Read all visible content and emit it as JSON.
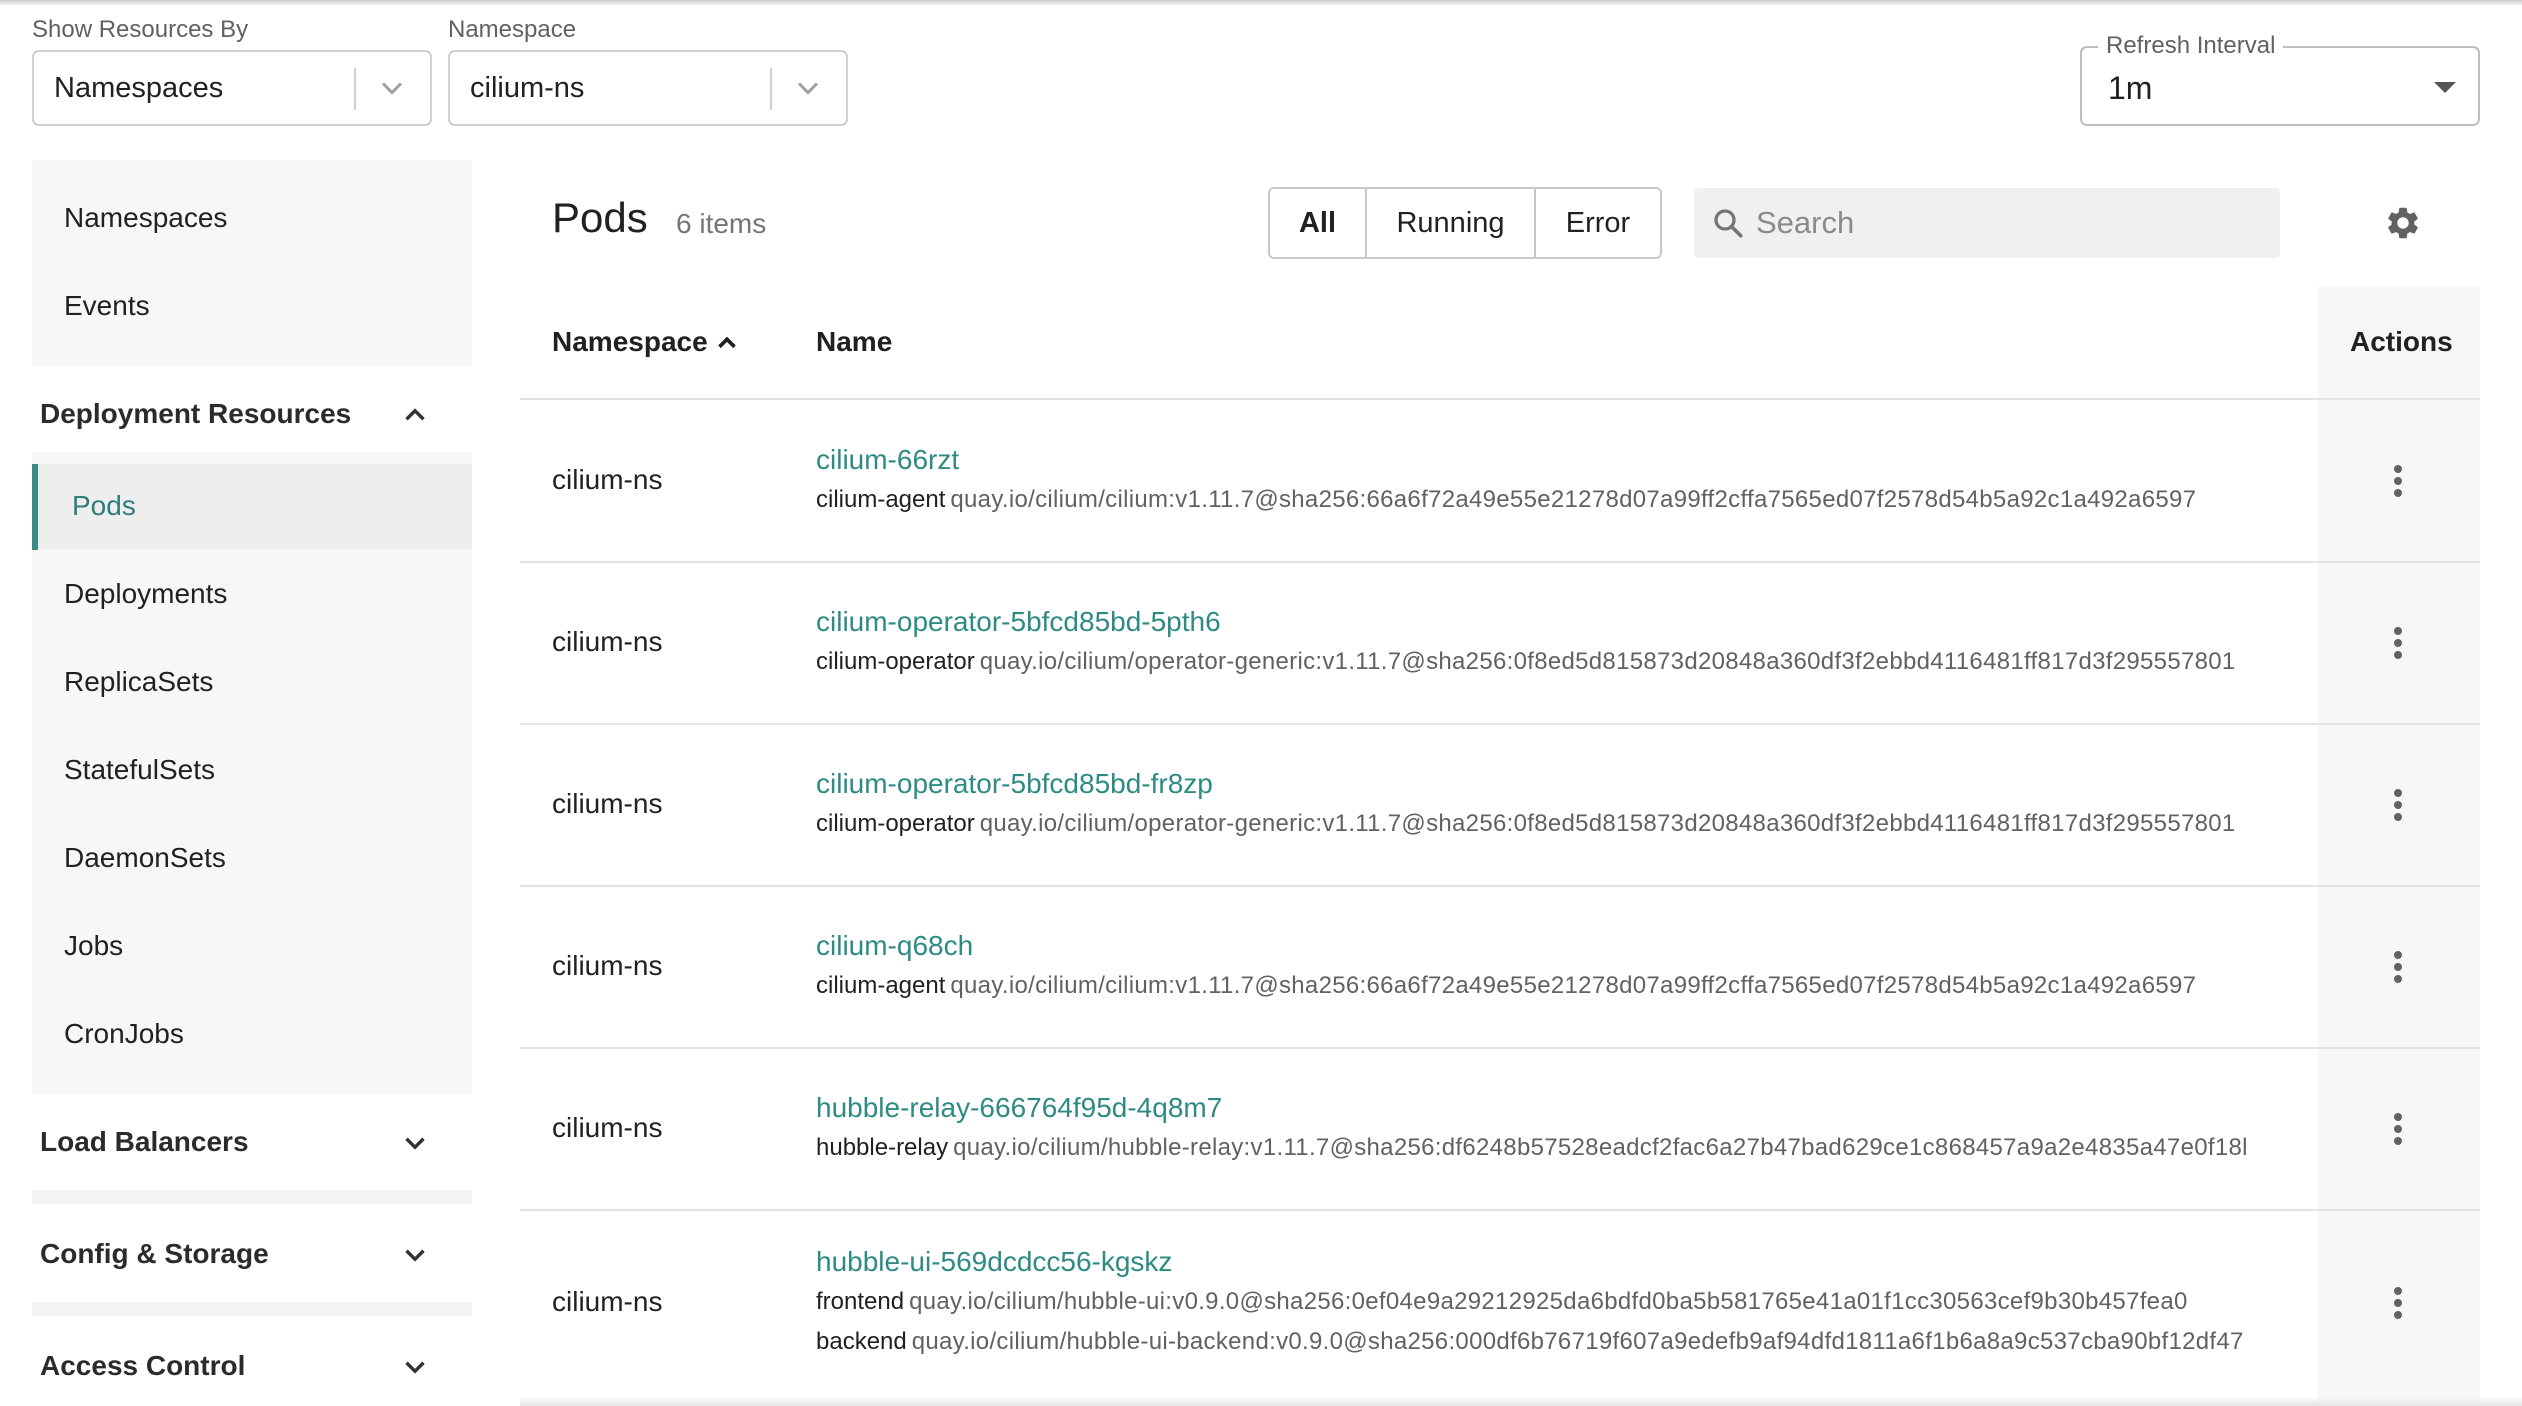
{
  "filters": {
    "show_resources_by": {
      "label": "Show Resources By",
      "value": "Namespaces"
    },
    "namespace": {
      "label": "Namespace",
      "value": "cilium-ns"
    },
    "refresh_interval": {
      "label": "Refresh Interval",
      "value": "1m"
    }
  },
  "sidebar": {
    "top_items": [
      "Namespaces",
      "Events"
    ],
    "deployment_resources": {
      "title": "Deployment Resources",
      "expanded": true,
      "items": [
        "Pods",
        "Deployments",
        "ReplicaSets",
        "StatefulSets",
        "DaemonSets",
        "Jobs",
        "CronJobs"
      ],
      "active": "Pods"
    },
    "sections": [
      "Load Balancers",
      "Config & Storage",
      "Access Control"
    ]
  },
  "main": {
    "title": "Pods",
    "count": "6 items",
    "status_filters": [
      "All",
      "Running",
      "Error"
    ],
    "active_filter": "All",
    "search_placeholder": "Search",
    "columns": {
      "namespace": "Namespace",
      "name": "Name",
      "actions": "Actions"
    },
    "rows": [
      {
        "namespace": "cilium-ns",
        "name": "cilium-66rzt",
        "containers": [
          {
            "name": "cilium-agent",
            "image": "quay.io/cilium/cilium:v1.11.7@sha256:66a6f72a49e55e21278d07a99ff2cffa7565ed07f2578d54b5a92c1a492a6597"
          }
        ]
      },
      {
        "namespace": "cilium-ns",
        "name": "cilium-operator-5bfcd85bd-5pth6",
        "containers": [
          {
            "name": "cilium-operator",
            "image": "quay.io/cilium/operator-generic:v1.11.7@sha256:0f8ed5d815873d20848a360df3f2ebbd4116481ff817d3f295557801"
          }
        ]
      },
      {
        "namespace": "cilium-ns",
        "name": "cilium-operator-5bfcd85bd-fr8zp",
        "containers": [
          {
            "name": "cilium-operator",
            "image": "quay.io/cilium/operator-generic:v1.11.7@sha256:0f8ed5d815873d20848a360df3f2ebbd4116481ff817d3f295557801"
          }
        ]
      },
      {
        "namespace": "cilium-ns",
        "name": "cilium-q68ch",
        "containers": [
          {
            "name": "cilium-agent",
            "image": "quay.io/cilium/cilium:v1.11.7@sha256:66a6f72a49e55e21278d07a99ff2cffa7565ed07f2578d54b5a92c1a492a6597"
          }
        ]
      },
      {
        "namespace": "cilium-ns",
        "name": "hubble-relay-666764f95d-4q8m7",
        "containers": [
          {
            "name": "hubble-relay",
            "image": "quay.io/cilium/hubble-relay:v1.11.7@sha256:df6248b57528eadcf2fac6a27b47bad629ce1c868457a9a2e4835a47e0f18l"
          }
        ]
      },
      {
        "namespace": "cilium-ns",
        "name": "hubble-ui-569dcdcc56-kgskz",
        "containers": [
          {
            "name": "frontend",
            "image": "quay.io/cilium/hubble-ui:v0.9.0@sha256:0ef04e9a29212925da6bdfd0ba5b581765e41a01f1cc30563cef9b30b457fea0"
          },
          {
            "name": "backend",
            "image": "quay.io/cilium/hubble-ui-backend:v0.9.0@sha256:000df6b76719f607a9edefb9af94dfd1811a6f1b6a8a9c537cba90bf12df47"
          }
        ]
      }
    ]
  },
  "colors": {
    "accent": "#2e8b84",
    "active_bar": "#3d8a85",
    "panel_bg": "#f7f7f7"
  },
  "icons": [
    "chevron-down-icon",
    "chevron-up-icon",
    "search-icon",
    "gear-icon",
    "sort-ascending-icon",
    "more-vertical-icon",
    "dropdown-caret-icon"
  ]
}
